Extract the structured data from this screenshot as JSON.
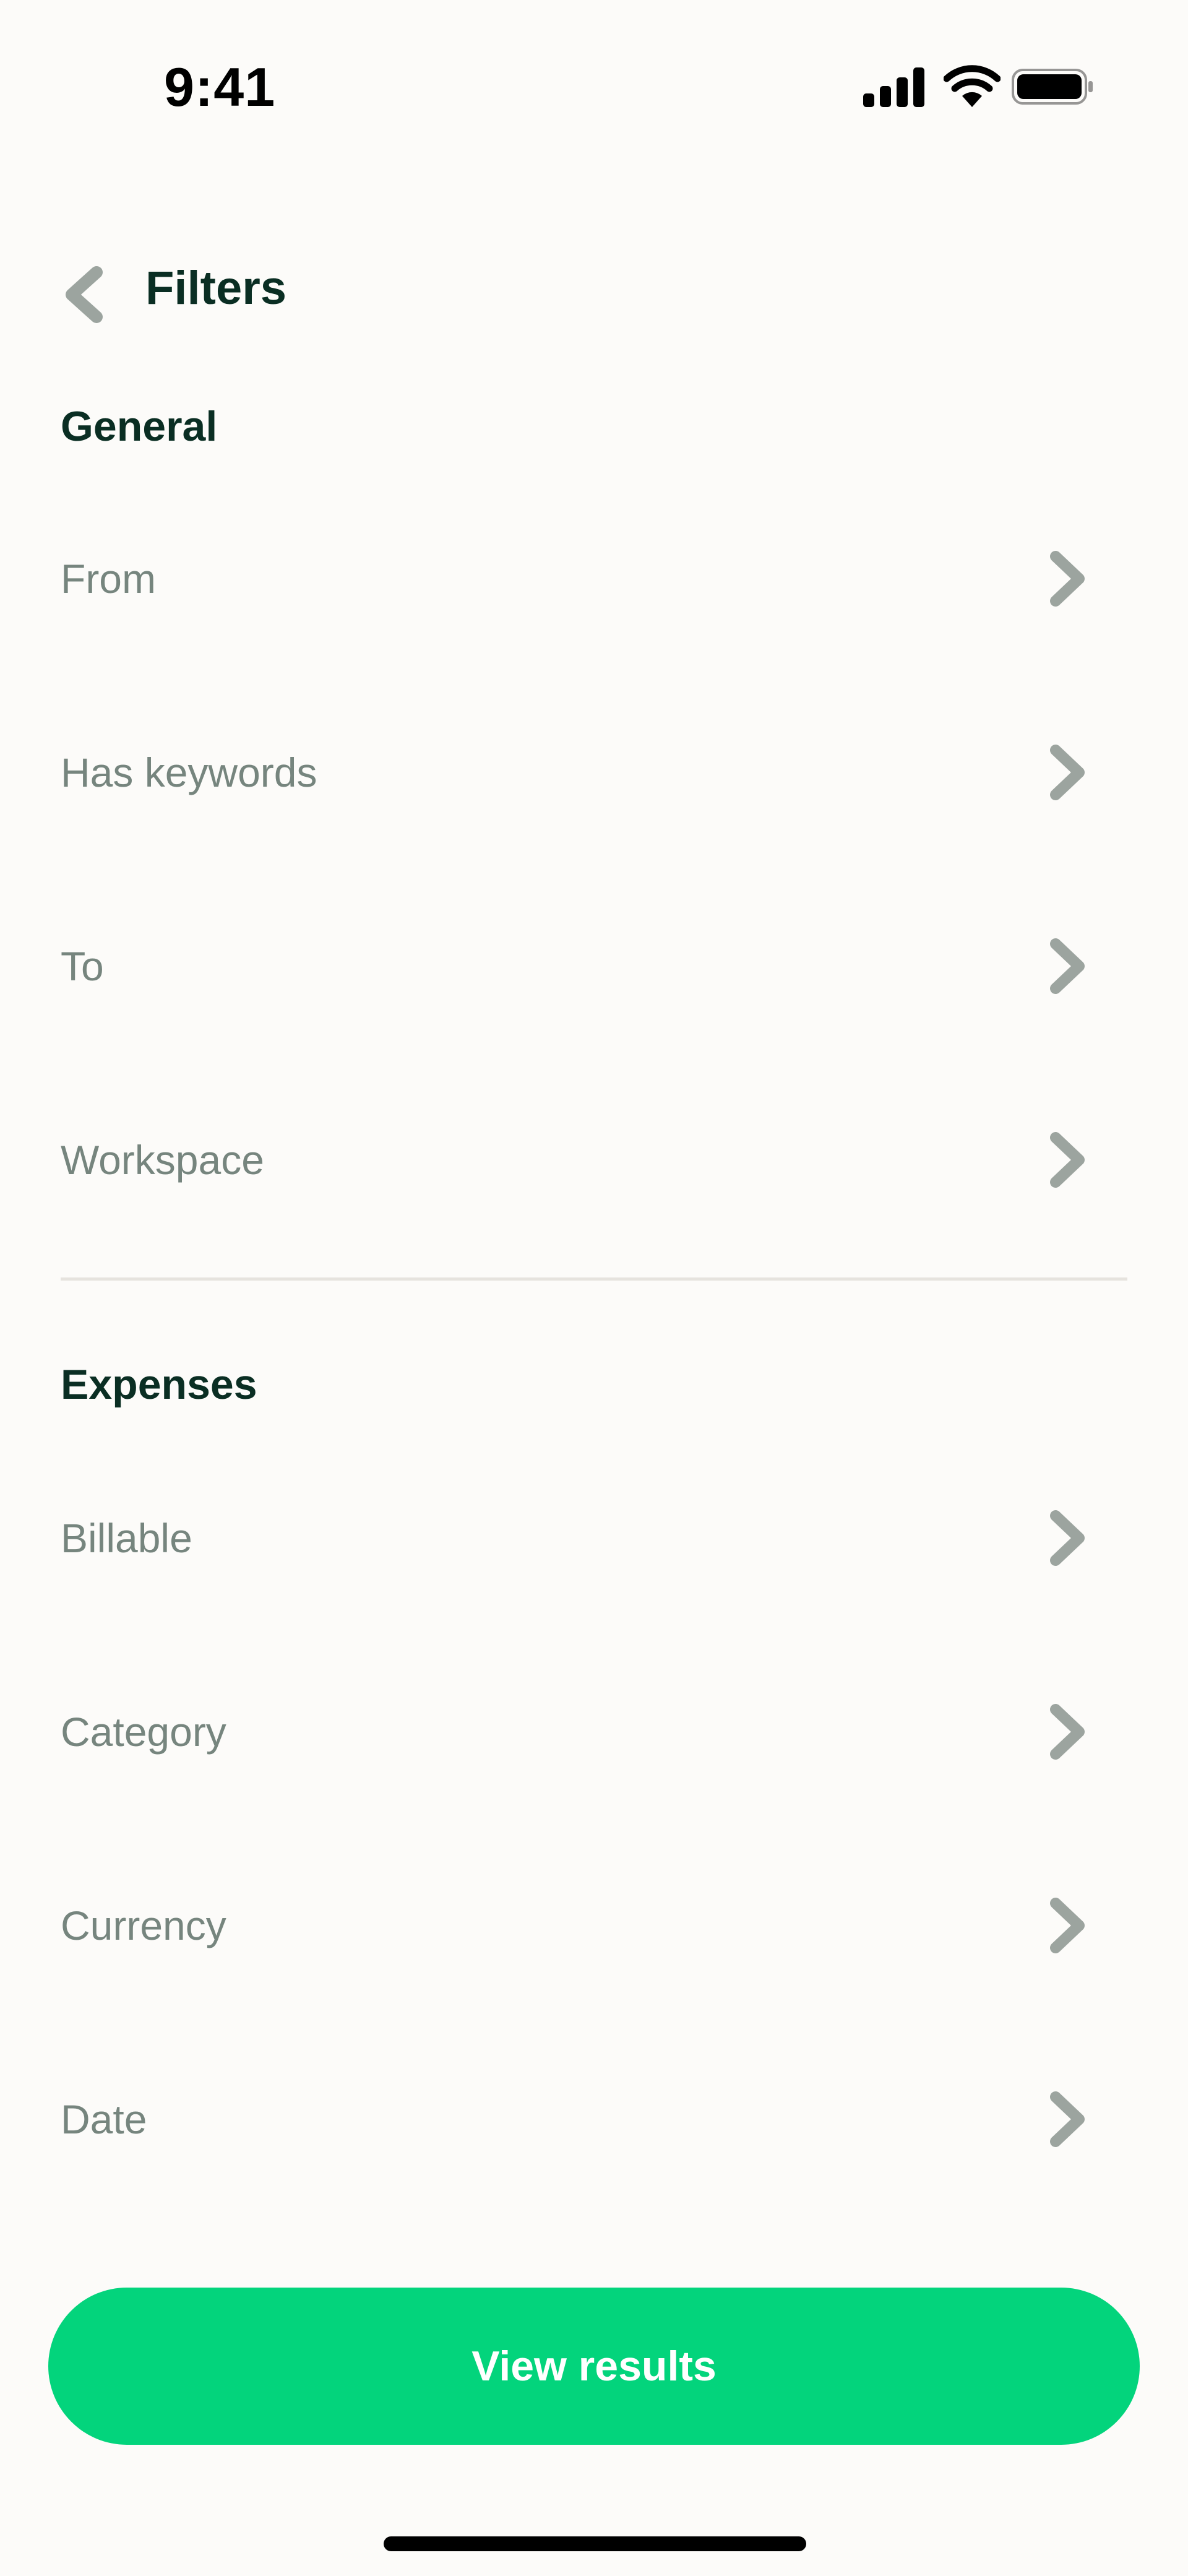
{
  "status_bar": {
    "time": "9:41",
    "icons": [
      "signal-icon",
      "wifi-icon",
      "battery-icon"
    ]
  },
  "header": {
    "title": "Filters",
    "back_icon": "chevron-left-icon"
  },
  "sections": {
    "general": {
      "heading": "General",
      "items": [
        {
          "label": "From"
        },
        {
          "label": "Has keywords"
        },
        {
          "label": "To"
        },
        {
          "label": "Workspace"
        }
      ]
    },
    "expenses": {
      "heading": "Expenses",
      "items": [
        {
          "label": "Billable"
        },
        {
          "label": "Category"
        },
        {
          "label": "Currency"
        },
        {
          "label": "Date"
        }
      ]
    }
  },
  "footer": {
    "button_label": "View results"
  },
  "colors": {
    "accent": "#03D47C",
    "heading": "#0A2E23",
    "label": "#76857E",
    "chevron": "#9CA49F",
    "background": "#FCFBF9",
    "divider": "#E6E3DE"
  }
}
